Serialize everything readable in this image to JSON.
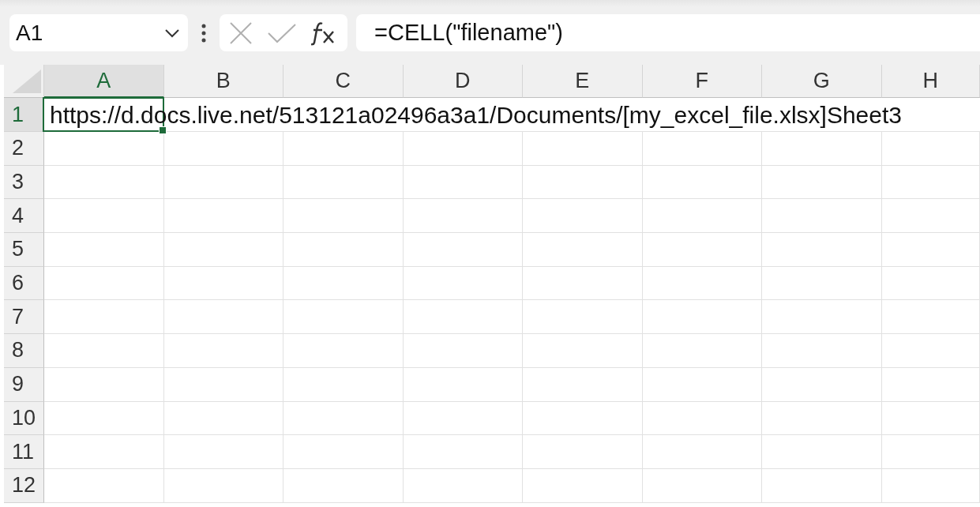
{
  "name_box": {
    "value": "A1"
  },
  "formula_bar": {
    "value": "=CELL(\"filename\")"
  },
  "columns": [
    {
      "label": "A",
      "selected": true
    },
    {
      "label": "B",
      "selected": false
    },
    {
      "label": "C",
      "selected": false
    },
    {
      "label": "D",
      "selected": false
    },
    {
      "label": "E",
      "selected": false
    },
    {
      "label": "F",
      "selected": false
    },
    {
      "label": "G",
      "selected": false
    },
    {
      "label": "H",
      "selected": false
    }
  ],
  "rows": [
    {
      "label": "1",
      "selected": true,
      "cells": [
        {
          "value": "https://d.docs.live.net/513121a02496a3a1/Documents/[my_excel_file.xlsx]Sheet3",
          "selected": true
        }
      ]
    },
    {
      "label": "2",
      "selected": false
    },
    {
      "label": "3",
      "selected": false
    },
    {
      "label": "4",
      "selected": false
    },
    {
      "label": "5",
      "selected": false
    },
    {
      "label": "6",
      "selected": false
    },
    {
      "label": "7",
      "selected": false
    },
    {
      "label": "8",
      "selected": false
    },
    {
      "label": "9",
      "selected": false
    },
    {
      "label": "10",
      "selected": false
    },
    {
      "label": "11",
      "selected": false
    },
    {
      "label": "12",
      "selected": false
    }
  ]
}
